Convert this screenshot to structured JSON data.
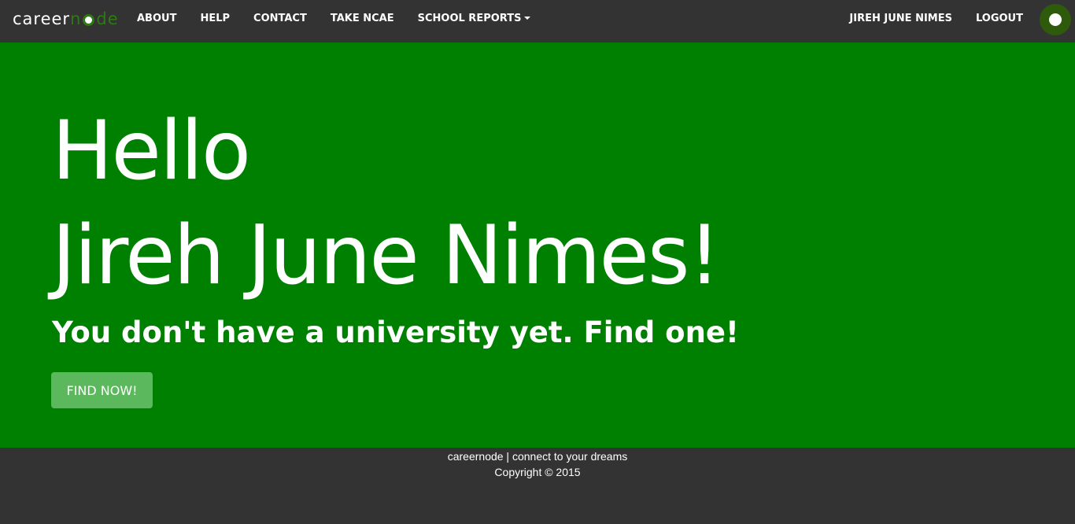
{
  "navbar": {
    "brand": {
      "part_a": "career",
      "part_b": "n",
      "part_c": "de"
    },
    "links": {
      "about": "ABOUT",
      "help": "HELP",
      "contact": "CONTACT",
      "take_ncae": "TAKE NCAE",
      "school_reports": "SCHOOL REPORTS"
    },
    "user_name": "JIREH JUNE NIMES",
    "logout": "LOGOUT",
    "power_icon": "power-toggle-icon"
  },
  "hero": {
    "greeting": "Hello",
    "name": "Jireh June Nimes!",
    "subtitle": "You don't have a university yet. Find one!",
    "button_label": "FIND NOW!"
  },
  "footer": {
    "tagline": "careernode | connect to your dreams",
    "copyright": "Copyright © 2015"
  },
  "colors": {
    "navbar_bg": "#333333",
    "hero_bg": "#008000",
    "button_bg": "#5cb85c",
    "brand_accent": "#2d7a12"
  }
}
